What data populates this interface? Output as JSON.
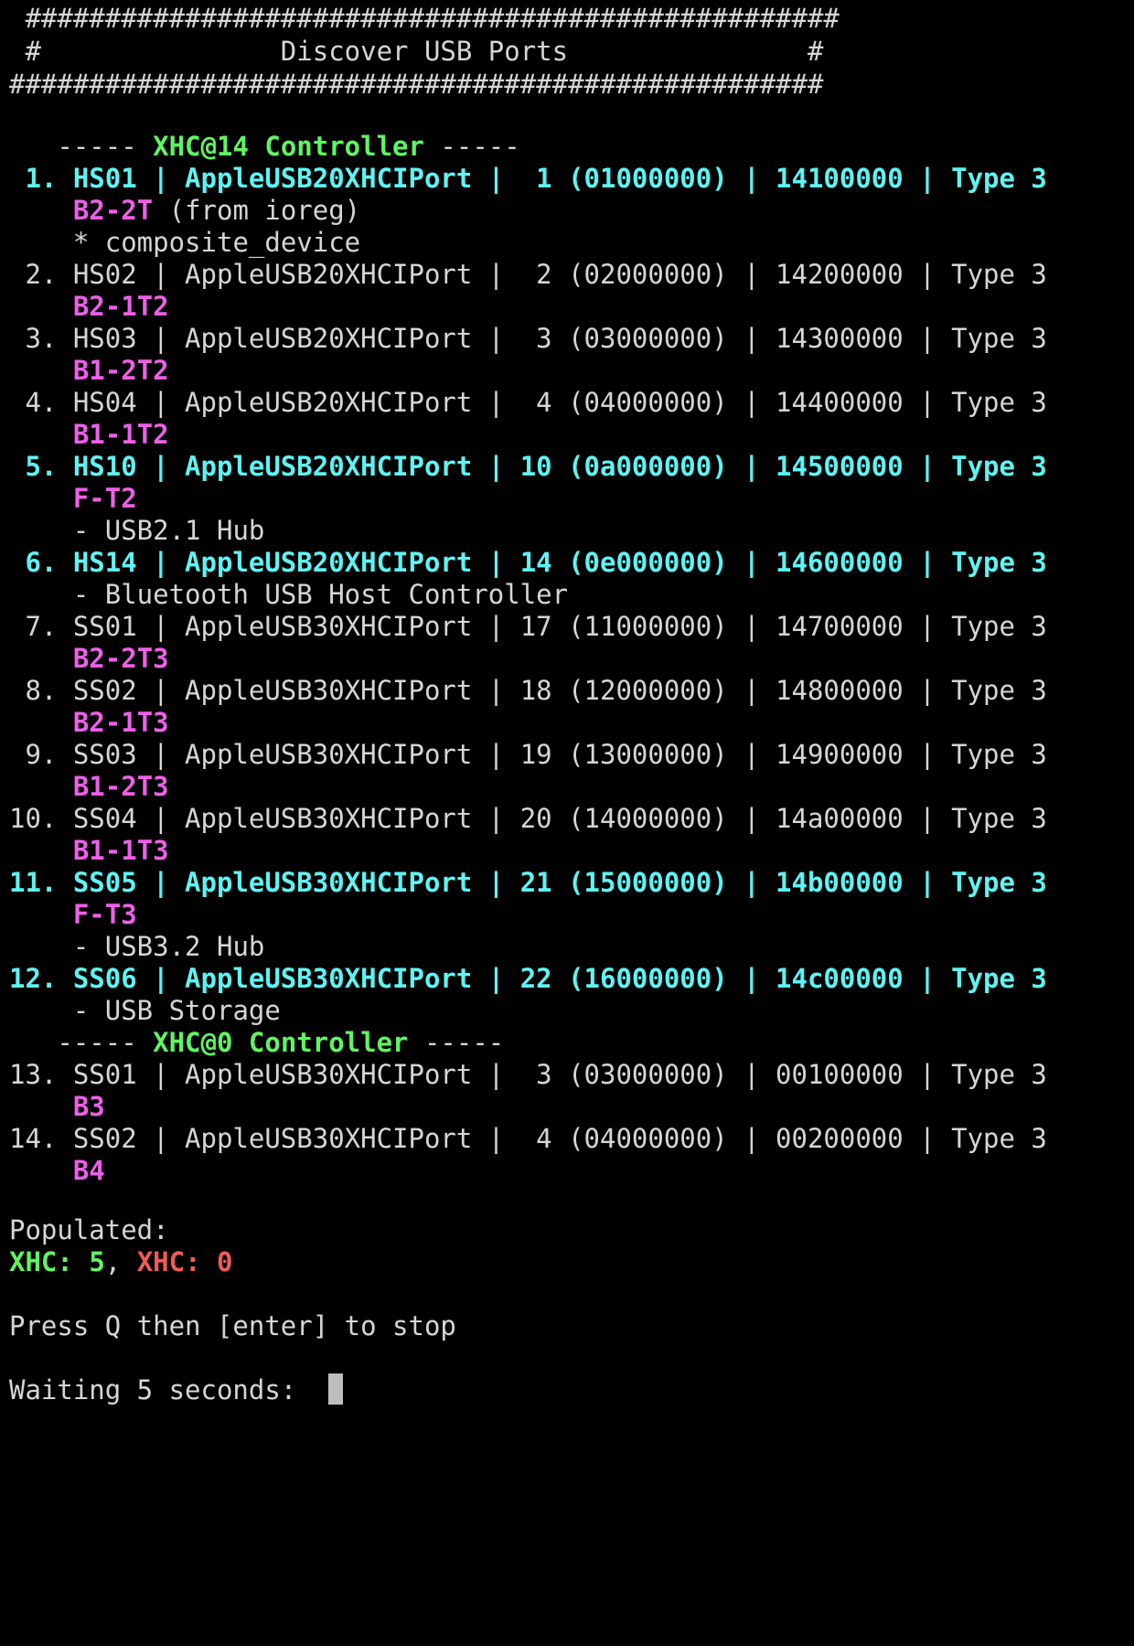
{
  "title": {
    "border_top": " ###################################################",
    "text": " #               Discover USB Ports               #",
    "border_bottom": "###################################################"
  },
  "controllers": [
    {
      "label": "XHC@14 Controller",
      "dashes_left": "   ----- ",
      "dashes_right": " -----"
    },
    {
      "label": "XHC@0 Controller",
      "dashes_left": "   ----- ",
      "dashes_right": " -----"
    }
  ],
  "ports": [
    {
      "text": " 1. HS01 | AppleUSB20XHCIPort |  1 (01000000) | 14100000 | Type 3",
      "alias": "B2-2T",
      "alias_suffix": " (from ioreg)",
      "extra": "* composite_device",
      "highlight": true
    },
    {
      "text": " 2. HS02 | AppleUSB20XHCIPort |  2 (02000000) | 14200000 | Type 3",
      "alias": "B2-1T2",
      "highlight": false
    },
    {
      "text": " 3. HS03 | AppleUSB20XHCIPort |  3 (03000000) | 14300000 | Type 3",
      "alias": "B1-2T2",
      "highlight": false
    },
    {
      "text": " 4. HS04 | AppleUSB20XHCIPort |  4 (04000000) | 14400000 | Type 3",
      "alias": "B1-1T2",
      "highlight": false
    },
    {
      "text": " 5. HS10 | AppleUSB20XHCIPort | 10 (0a000000) | 14500000 | Type 3",
      "alias": "F-T2",
      "extra": "- USB2.1 Hub",
      "highlight": true
    },
    {
      "text": " 6. HS14 | AppleUSB20XHCIPort | 14 (0e000000) | 14600000 | Type 3",
      "extra": "- Bluetooth USB Host Controller",
      "highlight": true
    },
    {
      "text": " 7. SS01 | AppleUSB30XHCIPort | 17 (11000000) | 14700000 | Type 3",
      "alias": "B2-2T3",
      "highlight": false
    },
    {
      "text": " 8. SS02 | AppleUSB30XHCIPort | 18 (12000000) | 14800000 | Type 3",
      "alias": "B2-1T3",
      "highlight": false
    },
    {
      "text": " 9. SS03 | AppleUSB30XHCIPort | 19 (13000000) | 14900000 | Type 3",
      "alias": "B1-2T3",
      "highlight": false
    },
    {
      "text": "10. SS04 | AppleUSB30XHCIPort | 20 (14000000) | 14a00000 | Type 3",
      "alias": "B1-1T3",
      "highlight": false
    },
    {
      "text": "11. SS05 | AppleUSB30XHCIPort | 21 (15000000) | 14b00000 | Type 3",
      "alias": "F-T3",
      "extra": "- USB3.2 Hub",
      "highlight": true
    },
    {
      "text": "12. SS06 | AppleUSB30XHCIPort | 22 (16000000) | 14c00000 | Type 3",
      "extra": "- USB Storage",
      "highlight": true
    },
    {
      "text": "13. SS01 | AppleUSB30XHCIPort |  3 (03000000) | 00100000 | Type 3",
      "alias": "B3",
      "highlight": false
    },
    {
      "text": "14. SS02 | AppleUSB30XHCIPort |  4 (04000000) | 00200000 | Type 3",
      "alias": "B4",
      "highlight": false
    }
  ],
  "populated": {
    "label": "Populated:",
    "first_name": "XHC:",
    "first_value": "5",
    "separator": ",",
    "second_name": "XHC:",
    "second_value": "0"
  },
  "prompt": "Press Q then [enter] to stop",
  "waiting": "Waiting 5 seconds:  ",
  "colors": {
    "background": "#000000",
    "text": "#d6d6d6",
    "active_port": "#5ff3f3",
    "controller": "#5ff560",
    "alias": "#ee5fe9",
    "unpopulated": "#f25a5a"
  }
}
